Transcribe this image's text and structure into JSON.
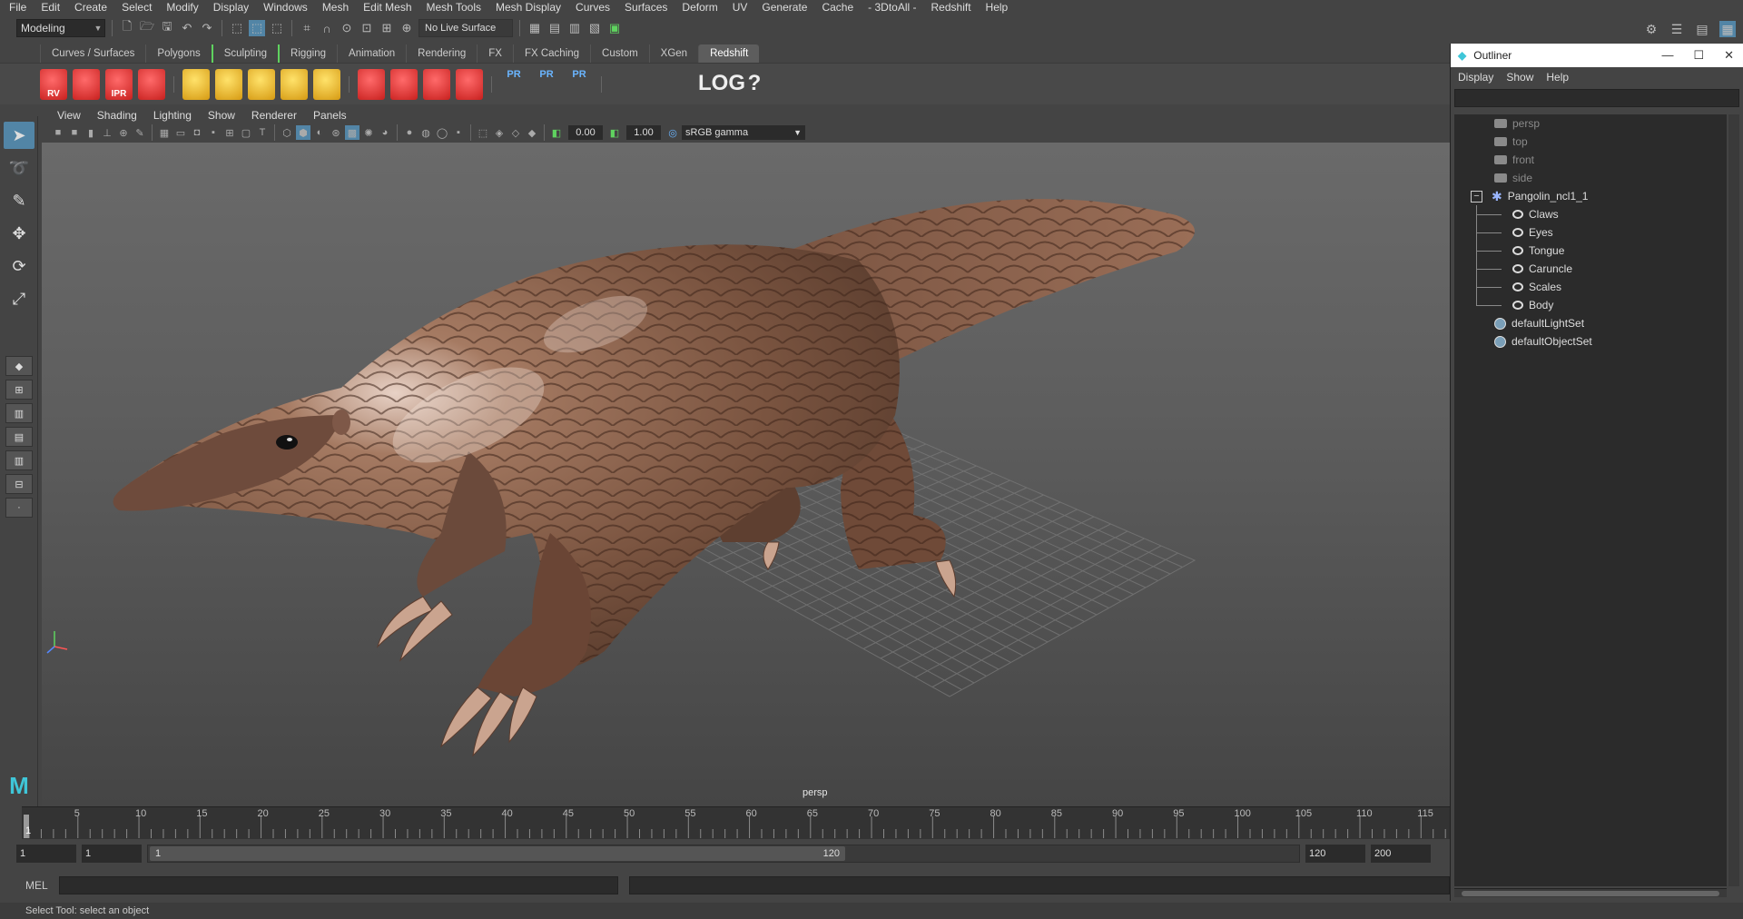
{
  "menubar": [
    "File",
    "Edit",
    "Create",
    "Select",
    "Modify",
    "Display",
    "Windows",
    "Mesh",
    "Edit Mesh",
    "Mesh Tools",
    "Mesh Display",
    "Curves",
    "Surfaces",
    "Deform",
    "UV",
    "Generate",
    "Cache",
    "- 3DtoAll -",
    "Redshift",
    "Help"
  ],
  "statusline": {
    "mode": "Modeling",
    "live_surface": "No Live Surface"
  },
  "shelf_tabs": [
    "Curves / Surfaces",
    "Polygons",
    "Sculpting",
    "Rigging",
    "Animation",
    "Rendering",
    "FX",
    "FX Caching",
    "Custom",
    "XGen",
    "Redshift"
  ],
  "shelf_active": "Redshift",
  "shelf_icons": [
    {
      "name": "redshift-rv-icon",
      "label": "RV",
      "kind": "red"
    },
    {
      "name": "redshift-render-icon",
      "label": "",
      "kind": "red"
    },
    {
      "name": "redshift-ipr-icon",
      "label": "IPR",
      "kind": "red"
    },
    {
      "name": "redshift-settings-icon",
      "label": "",
      "kind": "red"
    },
    {
      "name": "area-light-icon",
      "label": "",
      "kind": "yel"
    },
    {
      "name": "portal-light-icon",
      "label": "",
      "kind": "yel"
    },
    {
      "name": "spot-light-icon",
      "label": "",
      "kind": "yel"
    },
    {
      "name": "dome-light-icon",
      "label": "",
      "kind": "yel"
    },
    {
      "name": "sun-light-icon",
      "label": "",
      "kind": "yel"
    },
    {
      "name": "redshift-material-icon",
      "label": "",
      "kind": "red"
    },
    {
      "name": "redshift-hair-icon",
      "label": "",
      "kind": "red"
    },
    {
      "name": "redshift-curve-icon",
      "label": "",
      "kind": "red"
    },
    {
      "name": "redshift-sphere-icon",
      "label": "",
      "kind": "red"
    },
    {
      "name": "proxy-export-icon",
      "label": "PR",
      "kind": "pr"
    },
    {
      "name": "proxy-import-icon",
      "label": "PR",
      "kind": "pr"
    },
    {
      "name": "proxy-swap-icon",
      "label": "PR",
      "kind": "pr"
    },
    {
      "name": "aov-icon",
      "label": "",
      "kind": "wht"
    },
    {
      "name": "aov2-icon",
      "label": "",
      "kind": "wht"
    },
    {
      "name": "code-editor-icon",
      "label": "",
      "kind": "wht"
    },
    {
      "name": "log-icon",
      "label": "LOG",
      "kind": "wht"
    },
    {
      "name": "help-icon",
      "label": "?",
      "kind": "wht"
    }
  ],
  "panel_menu": [
    "View",
    "Shading",
    "Lighting",
    "Show",
    "Renderer",
    "Panels"
  ],
  "panel_toolbar": {
    "exposure": "0.00",
    "gamma_value": "1.00",
    "color_space": "sRGB gamma"
  },
  "viewport": {
    "camera_label": "persp"
  },
  "timeline": {
    "ticks": [
      5,
      10,
      15,
      20,
      25,
      30,
      35,
      40,
      45,
      50,
      55,
      60,
      65,
      70,
      75,
      80,
      85,
      90,
      95,
      100,
      105,
      110,
      115
    ],
    "current": "1"
  },
  "range": {
    "start": "1",
    "playback_start": "1",
    "slider_start": "1",
    "slider_end": "120",
    "playback_end": "120",
    "end": "200"
  },
  "command": {
    "label": "MEL"
  },
  "help_line": "Select Tool: select an object",
  "outliner": {
    "title": "Outliner",
    "menu": [
      "Display",
      "Show",
      "Help"
    ],
    "cameras": [
      "persp",
      "top",
      "front",
      "side"
    ],
    "group": "Pangolin_ncl1_1",
    "children": [
      "Claws",
      "Eyes",
      "Tongue",
      "Caruncle",
      "Scales",
      "Body"
    ],
    "sets": [
      "defaultLightSet",
      "defaultObjectSet"
    ]
  }
}
